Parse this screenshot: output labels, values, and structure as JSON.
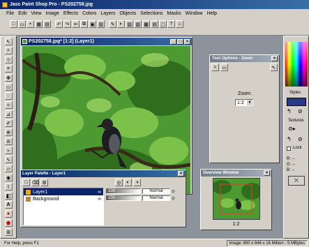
{
  "app": {
    "title": "Jasc Paint Shop Pro - PS202758.jpg",
    "menu": [
      "File",
      "Edit",
      "View",
      "Image",
      "Effects",
      "Colors",
      "Layers",
      "Objects",
      "Selections",
      "Masks",
      "Window",
      "Help"
    ]
  },
  "image_window": {
    "title": "PS202758.jpg* [1:2] (Layer1)"
  },
  "tool_options": {
    "title": "Tool Options - Zoom",
    "zoom_label": "Zoom:",
    "zoom_value": "1:2"
  },
  "layer_palette": {
    "title": "Layer Palette - Layer1",
    "layers": [
      {
        "name": "Layer1",
        "opacity": "100",
        "blend": "Normal",
        "selected": true
      },
      {
        "name": "Background",
        "opacity": "100",
        "blend": "Normal",
        "selected": false
      }
    ]
  },
  "overview": {
    "title": "Overview Window",
    "zoom": "1:2"
  },
  "right_panel": {
    "styles_label": "Styles",
    "textures_label": "Textures",
    "lock_label": "Lock",
    "rgb_labels": [
      "R:",
      "G:",
      "B:"
    ],
    "rgb_values": [
      "--",
      "--",
      "--"
    ]
  },
  "status": {
    "help": "For Help, press F1",
    "image_info": "Image: 800 x 646 x 16 Million - 5 MBytes"
  },
  "colors": {
    "accent": "#0a246a",
    "foliage": "#3f8a2a"
  }
}
